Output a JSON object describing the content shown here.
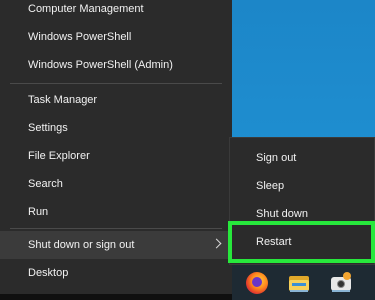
{
  "main_menu": {
    "items": [
      {
        "label": "Computer Management"
      },
      {
        "label": "Windows PowerShell"
      },
      {
        "label": "Windows PowerShell (Admin)"
      },
      {
        "label": "Task Manager"
      },
      {
        "label": "Settings"
      },
      {
        "label": "File Explorer"
      },
      {
        "label": "Search"
      },
      {
        "label": "Run"
      },
      {
        "label": "Shut down or sign out",
        "has_submenu": true,
        "highlighted": true
      },
      {
        "label": "Desktop"
      }
    ]
  },
  "submenu": {
    "items": [
      {
        "label": "Sign out"
      },
      {
        "label": "Sleep"
      },
      {
        "label": "Shut down"
      },
      {
        "label": "Restart",
        "emphasized": true
      }
    ],
    "highlight_color": "#27e83c"
  },
  "taskbar": {
    "icons": [
      "firefox-icon",
      "file-explorer-icon",
      "camera-app-icon"
    ]
  },
  "colors": {
    "menu_bg": "#2b2b2b",
    "menu_hover": "#3b3b3b",
    "desktop_blue": "#1d84c6"
  }
}
